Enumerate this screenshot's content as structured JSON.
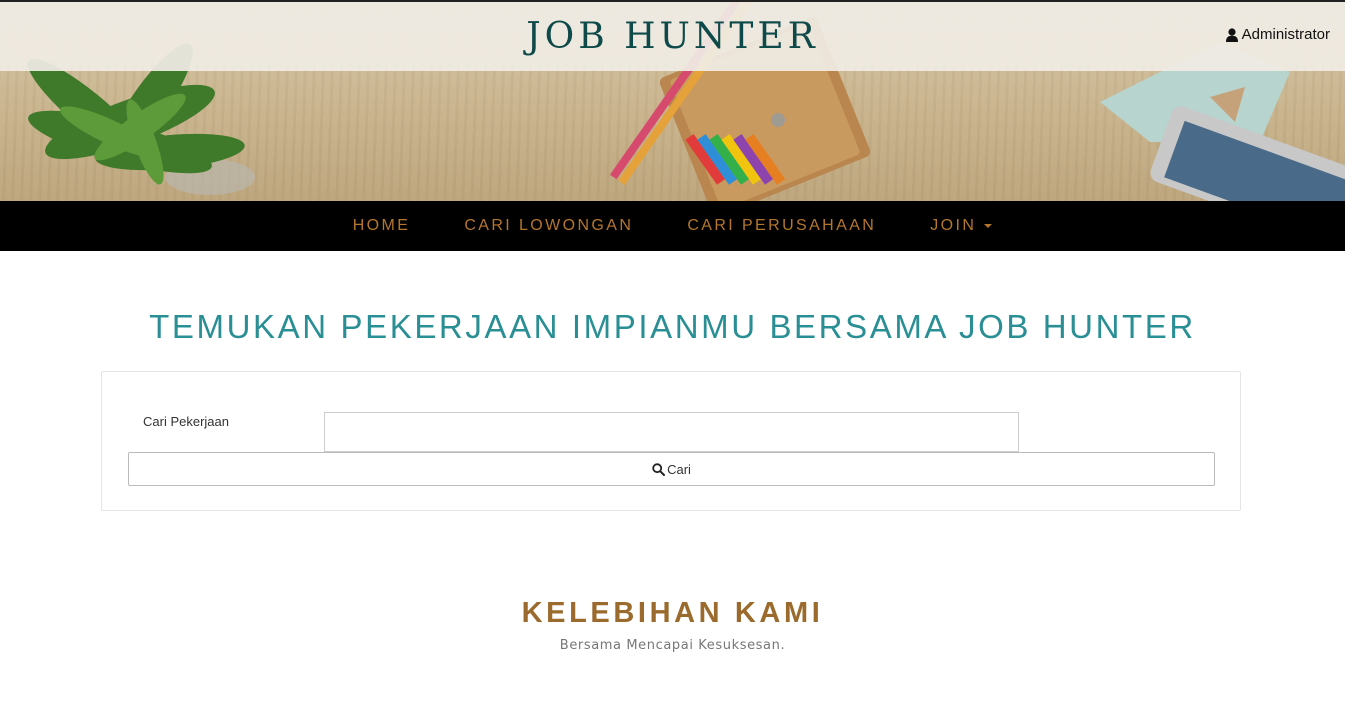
{
  "header": {
    "brand": "JOB HUNTER",
    "user_label": "Administrator",
    "user_icon": "user-icon"
  },
  "nav": {
    "items": [
      {
        "label": "HOME"
      },
      {
        "label": "CARI LOWONGAN"
      },
      {
        "label": "CARI PERUSAHAAN"
      },
      {
        "label": "JOIN",
        "dropdown": true
      }
    ]
  },
  "main": {
    "headline": "TEMUKAN PEKERJAAN IMPIANMU BERSAMA JOB HUNTER",
    "search": {
      "label": "Cari Pekerjaan",
      "value": "",
      "placeholder": "",
      "button_label": "Cari",
      "button_icon": "search-icon"
    },
    "section": {
      "title": "KELEBIHAN KAMI",
      "subtitle": "Bersama Mencapai Kesuksesan."
    }
  },
  "colors": {
    "brand": "#0f4a4a",
    "nav_bg": "#000000",
    "nav_text": "#b4762c",
    "headline": "#2a8f94",
    "section_title": "#9a6b2c"
  }
}
